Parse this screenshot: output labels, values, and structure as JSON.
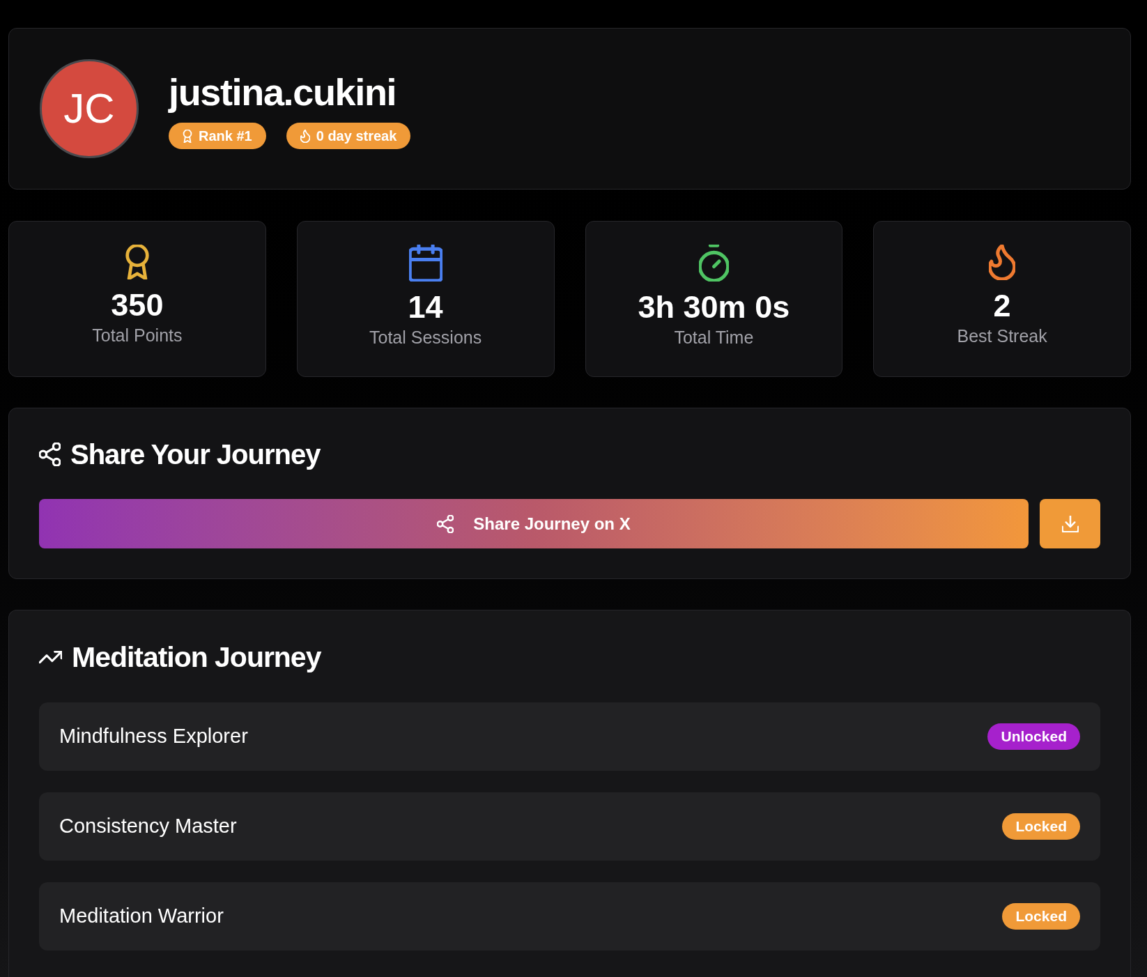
{
  "profile": {
    "initials": "JC",
    "username": "justina.cukini",
    "badges": [
      {
        "kind": "rank",
        "label": "Rank #1"
      },
      {
        "kind": "streak",
        "label": "0 day streak"
      }
    ]
  },
  "stats": [
    {
      "kind": "points",
      "value": "350",
      "label": "Total Points"
    },
    {
      "kind": "sessions",
      "value": "14",
      "label": "Total Sessions"
    },
    {
      "kind": "time",
      "value": "3h 30m 0s",
      "label": "Total Time"
    },
    {
      "kind": "streak",
      "value": "2",
      "label": "Best Streak"
    }
  ],
  "share": {
    "title": "Share Your Journey",
    "button": "Share Journey on X"
  },
  "journey": {
    "title": "Meditation Journey",
    "milestones": [
      {
        "name": "Mindfulness Explorer",
        "status": "Unlocked",
        "unlocked": true
      },
      {
        "name": "Consistency Master",
        "status": "Locked",
        "unlocked": false
      },
      {
        "name": "Meditation Warrior",
        "status": "Locked",
        "unlocked": false
      }
    ]
  }
}
